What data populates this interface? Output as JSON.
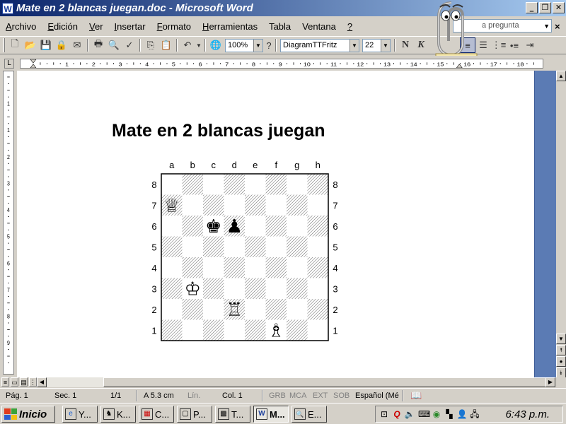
{
  "window": {
    "title": "Mate en 2 blancas juegan.doc - Microsoft Word",
    "app_icon": "W",
    "controls": [
      "_",
      "❐",
      "✕"
    ]
  },
  "menu": {
    "items": [
      {
        "ul": "A",
        "rest": "rchivo"
      },
      {
        "ul": "E",
        "rest": "dición"
      },
      {
        "ul": "V",
        "rest": "er"
      },
      {
        "ul": "I",
        "rest": "nsertar"
      },
      {
        "ul": "F",
        "rest": "ormato"
      },
      {
        "ul": "H",
        "rest": "erramientas"
      },
      {
        "ul": "",
        "rest": "Tabla"
      },
      {
        "ul": "",
        "rest": "Ventana"
      },
      {
        "ul": "?",
        "rest": ""
      }
    ],
    "help_placeholder": "a pregunta"
  },
  "toolbar": {
    "zoom": "100%",
    "font": "DiagramTTFritz",
    "size": "22",
    "bold": "N",
    "italic": "K"
  },
  "document": {
    "heading": "Mate en 2 blancas juegan",
    "board": {
      "files": [
        "a",
        "b",
        "c",
        "d",
        "e",
        "f",
        "g",
        "h"
      ],
      "ranks": [
        "8",
        "7",
        "6",
        "5",
        "4",
        "3",
        "2",
        "1"
      ],
      "pieces": [
        {
          "square": "a7",
          "glyph": "♕",
          "name": "white-queen"
        },
        {
          "square": "c6",
          "glyph": "♚",
          "name": "black-king"
        },
        {
          "square": "d6",
          "glyph": "♟",
          "name": "black-pawn"
        },
        {
          "square": "b3",
          "glyph": "♔",
          "name": "white-king"
        },
        {
          "square": "d2",
          "glyph": "♖",
          "name": "white-rook"
        },
        {
          "square": "f1",
          "glyph": "♗",
          "name": "white-bishop"
        }
      ]
    }
  },
  "ruler": {
    "h_ticks": [
      "1",
      "2",
      "3",
      "4",
      "5",
      "6",
      "7",
      "8",
      "9",
      "10",
      "11",
      "12",
      "13",
      "14",
      "15",
      "16",
      "17",
      "18"
    ],
    "v_ticks": [
      "1",
      "1",
      "2",
      "3",
      "4",
      "5",
      "6",
      "7",
      "8",
      "9"
    ]
  },
  "status": {
    "page": "Pág.  1",
    "section": "Sec.  1",
    "pages": "1/1",
    "at": "A  5.3 cm",
    "line": "Lín.",
    "col": "Col.  1",
    "grb": "GRB",
    "mca": "MCA",
    "ext": "EXT",
    "sob": "SOB",
    "lang": "Español (Mé"
  },
  "taskbar": {
    "start": "Inicio",
    "buttons": [
      {
        "label": "Y...",
        "icon": "e"
      },
      {
        "label": "K...",
        "icon": "♞"
      },
      {
        "label": "C...",
        "icon": "▦"
      },
      {
        "label": "P...",
        "icon": "▢"
      },
      {
        "label": "T...",
        "icon": "▩"
      },
      {
        "label": "M...",
        "icon": "W"
      },
      {
        "label": "E...",
        "icon": "🔍"
      }
    ],
    "clock": "6:43 p.m."
  }
}
